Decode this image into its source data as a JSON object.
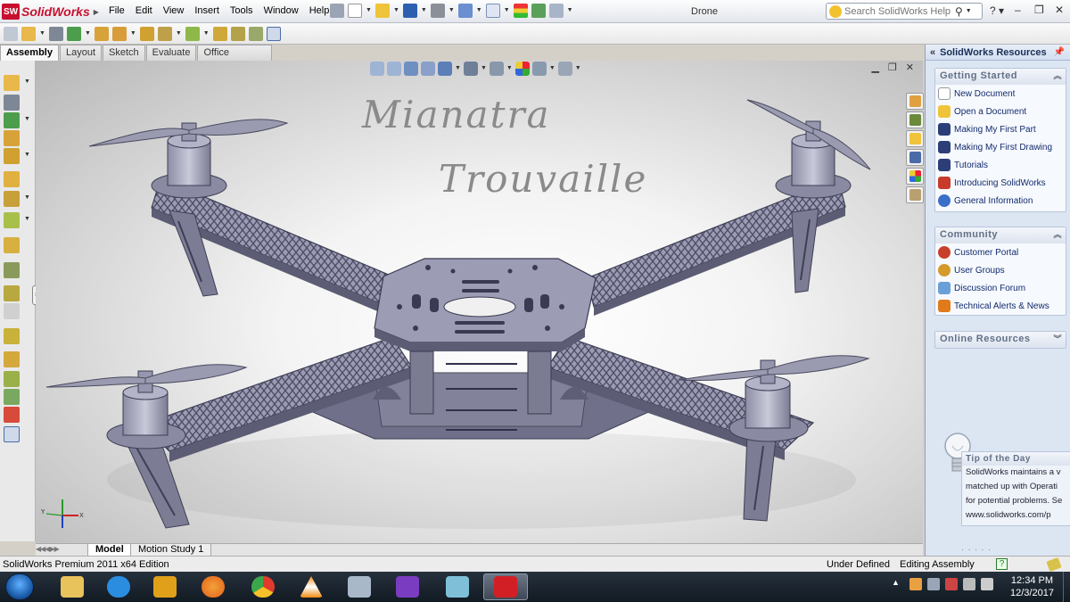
{
  "app": {
    "logo_badge": "SW",
    "logo_text": "SolidWorks",
    "document_title": "Drone"
  },
  "menu": [
    "File",
    "Edit",
    "View",
    "Insert",
    "Tools",
    "Window",
    "Help"
  ],
  "search": {
    "placeholder": "Search SolidWorks Help"
  },
  "cm_tabs": [
    {
      "label": "Assembly",
      "active": true
    },
    {
      "label": "Layout"
    },
    {
      "label": "Sketch"
    },
    {
      "label": "Evaluate"
    },
    {
      "label": "Office Products"
    }
  ],
  "watermark": {
    "line1": "Mianatra",
    "line2": "Trouvaille"
  },
  "model_tabs": [
    {
      "label": "Model",
      "active": true
    },
    {
      "label": "Motion Study 1"
    }
  ],
  "resources": {
    "title": "SolidWorks Resources",
    "groups": [
      {
        "title": "Getting Started",
        "items": [
          {
            "label": "New Document",
            "icon": "new-document-icon",
            "color": "#ffffff"
          },
          {
            "label": "Open a Document",
            "icon": "open-folder-icon",
            "color": "#f0c43a"
          },
          {
            "label": "Making My First Part",
            "icon": "grad-cap-icon",
            "color": "#2b3e78"
          },
          {
            "label": "Making My First Drawing",
            "icon": "grad-cap-icon",
            "color": "#2b3e78"
          },
          {
            "label": "Tutorials",
            "icon": "grad-cap-icon",
            "color": "#2b3e78"
          },
          {
            "label": "Introducing SolidWorks",
            "icon": "intro-icon",
            "color": "#c83a2a"
          },
          {
            "label": "General Information",
            "icon": "info-icon",
            "color": "#3a6ec8"
          }
        ]
      },
      {
        "title": "Community",
        "items": [
          {
            "label": "Customer Portal",
            "icon": "portal-icon",
            "color": "#c8402a"
          },
          {
            "label": "User Groups",
            "icon": "users-icon",
            "color": "#d49a2a"
          },
          {
            "label": "Discussion Forum",
            "icon": "forum-icon",
            "color": "#6aa0d8"
          },
          {
            "label": "Technical Alerts & News",
            "icon": "rss-icon",
            "color": "#e07a1a"
          }
        ]
      },
      {
        "title": "Online Resources",
        "items": []
      }
    ],
    "tip": {
      "title": "Tip of the Day",
      "lines": [
        "SolidWorks maintains a v",
        "matched up with Operati",
        "for potential problems. Se",
        "www.solidworks.com/p"
      ]
    }
  },
  "status": {
    "edition": "SolidWorks Premium 2011 x64 Edition",
    "state": "Under Defined",
    "mode": "Editing Assembly",
    "rebuild_symbol": "?"
  },
  "clock": {
    "time": "12:34 PM",
    "date": "12/3/2017"
  },
  "taskbar_apps": [
    {
      "name": "file-explorer",
      "color": "#e8c25a"
    },
    {
      "name": "internet-explorer",
      "color": "#2a8de0"
    },
    {
      "name": "media-player",
      "color": "#e0a01a"
    },
    {
      "name": "firefox",
      "color": "#e2601a"
    },
    {
      "name": "chrome",
      "color": "#3aa84a"
    },
    {
      "name": "vlc",
      "color": "#f08a10"
    },
    {
      "name": "calculator",
      "color": "#a8b8c8"
    },
    {
      "name": "visual-studio",
      "color": "#7a3cc0"
    },
    {
      "name": "sketch-app",
      "color": "#7fc0d8"
    },
    {
      "name": "solidworks",
      "color": "#d21f26"
    }
  ]
}
